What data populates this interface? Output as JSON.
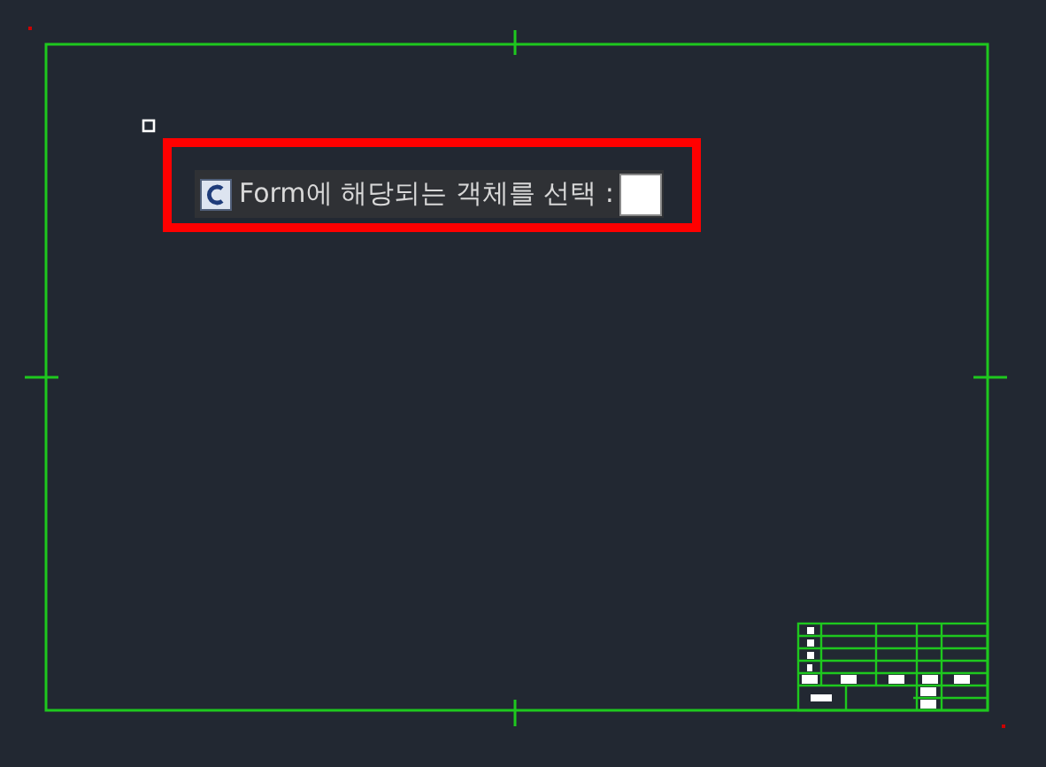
{
  "command_prompt": {
    "text": "Form에 해당되는 객체를 선택 :"
  }
}
